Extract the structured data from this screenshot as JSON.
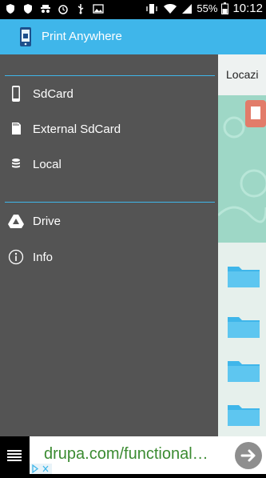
{
  "status_bar": {
    "left_icons": [
      "shield-icon",
      "shield-icon",
      "incognito-icon",
      "alarm-icon",
      "usb-icon",
      "image-icon"
    ],
    "battery": "55%",
    "time": "10:12"
  },
  "app_bar": {
    "title": "Print Anywhere"
  },
  "drawer": {
    "storage_items": [
      {
        "label": "SdCard",
        "icon": "phone-icon"
      },
      {
        "label": "External SdCard",
        "icon": "sdcard-icon"
      },
      {
        "label": "Local",
        "icon": "database-icon"
      }
    ],
    "other_items": [
      {
        "label": "Drive",
        "icon": "drive-icon"
      },
      {
        "label": "Info",
        "icon": "info-icon"
      }
    ]
  },
  "background_panel": {
    "header": "Locazi"
  },
  "ad": {
    "text": "drupa.com/functional…"
  },
  "colors": {
    "accent": "#3fb6ea",
    "drawer": "#545454",
    "folder": "#3fb6ea",
    "ad_text": "#3b8b31"
  }
}
